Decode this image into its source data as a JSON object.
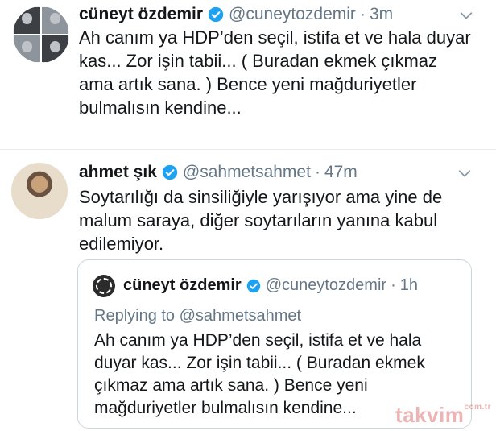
{
  "tweets": [
    {
      "name": "cüneyt özdemir",
      "handle": "@cuneytozdemir",
      "time": "3m",
      "lines": [
        "Ah canım ya HDP’den seçil, istifa et ve hala duyar",
        "kas... Zor işin tabii... ( Buradan ekmek çıkmaz",
        "ama artık sana. ) Bence yeni mağduriyetler",
        "bulmalısın kendine..."
      ]
    },
    {
      "name": "ahmet şık",
      "handle": "@sahmetsahmet",
      "time": "47m",
      "lines": [
        "Soytarılığı da sinsiliğiyle yarışıyor ama yine de",
        "malum saraya, diğer soytarıların yanına kabul",
        "edilemiyor."
      ]
    }
  ],
  "quoted": {
    "name": "cüneyt özdemir",
    "handle": "@cuneytozdemir",
    "time": "1h",
    "replying_prefix": "Replying to",
    "replying_to": "@sahmetsahmet",
    "lines": [
      "Ah canım ya HDP’den seçil, istifa et ve hala",
      "duyar kas... Zor işin tabii... ( Buradan ekmek",
      "çıkmaz ama artık sana. ) Bence yeni",
      "mağduriyetler bulmalısın kendine..."
    ]
  },
  "separator": "·",
  "watermark": "takvim",
  "watermark_suffix": "com.tr",
  "colors": {
    "text": "#14171a",
    "muted": "#657786",
    "verified": "#1da1f2",
    "border": "#ccd6dd"
  },
  "icons": [
    "verified-badge-icon",
    "chevron-down-icon"
  ]
}
